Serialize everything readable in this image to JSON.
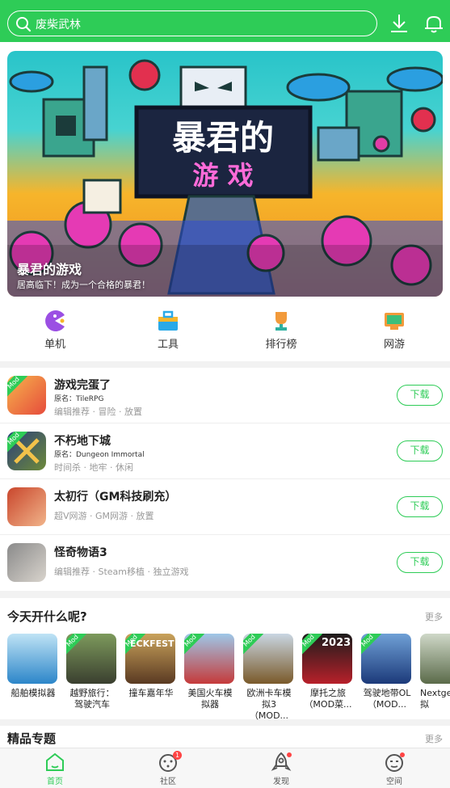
{
  "header": {
    "search_text": "废柴武林"
  },
  "banner": {
    "headline_art": "暴君的",
    "headline_art2": "游 戏",
    "title": "暴君的游戏",
    "subtitle": "居高临下！成为一个合格的暴君！"
  },
  "categories": [
    {
      "label": "单机",
      "icon": "pacman-icon"
    },
    {
      "label": "工具",
      "icon": "toolbox-icon"
    },
    {
      "label": "排行榜",
      "icon": "trophy-icon"
    },
    {
      "label": "网游",
      "icon": "gamepad-icon"
    }
  ],
  "games": [
    {
      "name": "游戏完蛋了",
      "original": "原名：TileRPG",
      "tags": "编辑推荐 · 冒险 · 放置",
      "button": "下载",
      "mod": "Mod"
    },
    {
      "name": "不朽地下城",
      "original": "原名：Dungeon Immortal",
      "tags": "时间杀 · 地牢 · 休闲",
      "button": "下载",
      "mod": "Mod"
    },
    {
      "name": "太初行（GM科技刷充）",
      "original": "",
      "tags": "超V网游 · GM网游 · 放置",
      "button": "下载",
      "mod": ""
    },
    {
      "name": "怪奇物语3",
      "original": "",
      "tags": "编辑推荐 · Steam移植 · 独立游戏",
      "button": "下载",
      "mod": ""
    }
  ],
  "today": {
    "title": "今天开什么呢?",
    "more": "更多",
    "items": [
      {
        "name": "船舶模拟器",
        "mod": ""
      },
      {
        "name": "越野旅行：驾驶汽车",
        "mod": "Mod"
      },
      {
        "name": "撞车嘉年华",
        "mod": "Mod",
        "thumb_text": "ECKFEST"
      },
      {
        "name": "美国火车模拟器",
        "mod": "Mod"
      },
      {
        "name": "欧洲卡车模拟3（MOD...",
        "mod": "Mod"
      },
      {
        "name": "摩托之旅（MOD菜...",
        "mod": "Mod",
        "thumb_text": "2023"
      },
      {
        "name": "驾驶地带OL（MOD...",
        "mod": "Mod"
      },
      {
        "name": "Nextge车模拟",
        "mod": ""
      }
    ]
  },
  "featured": {
    "title": "精品专题",
    "more": "更多"
  },
  "nav": [
    {
      "label": "首页",
      "active": true
    },
    {
      "label": "社区",
      "badge": "1"
    },
    {
      "label": "发现"
    },
    {
      "label": "空间"
    }
  ],
  "colors": {
    "brand": "#2ecc57",
    "badge": "#ff4444"
  }
}
